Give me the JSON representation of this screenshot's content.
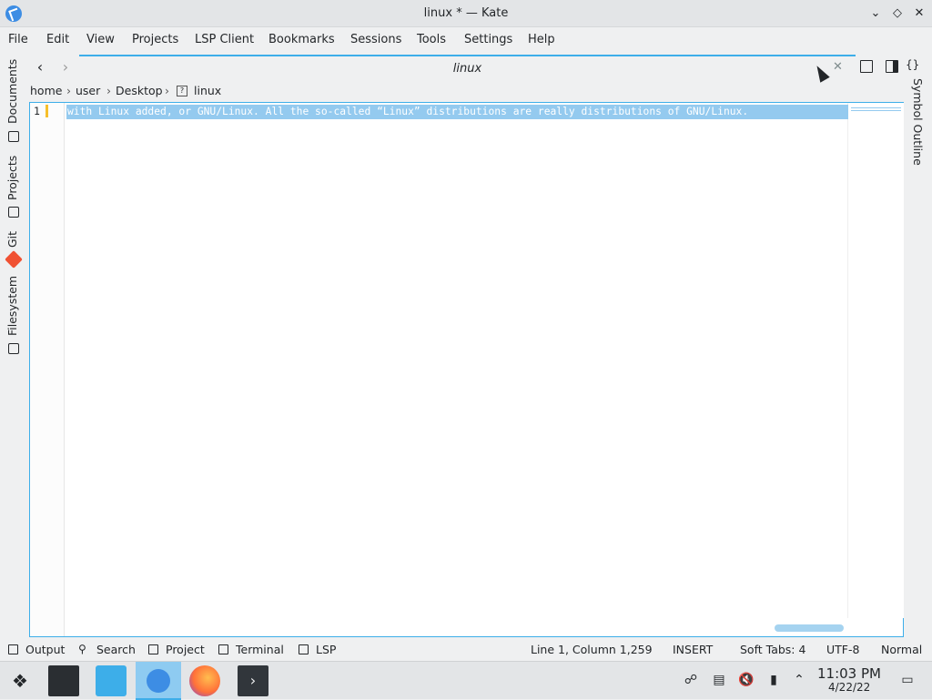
{
  "window": {
    "title": "linux * — Kate",
    "controls": [
      "minimize",
      "maximize",
      "close"
    ]
  },
  "menubar": {
    "items": [
      "File",
      "Edit",
      "View",
      "Projects",
      "LSP Client",
      "Bookmarks",
      "Sessions",
      "Tools",
      "Settings",
      "Help"
    ]
  },
  "left_sidebar": {
    "tabs": [
      "Documents",
      "Projects",
      "Git",
      "Filesystem"
    ]
  },
  "right_sidebar": {
    "tabs": [
      "Symbol Outline"
    ]
  },
  "tabs": {
    "active": "linux"
  },
  "breadcrumb": {
    "items": [
      "home",
      "user",
      "Desktop",
      "linux"
    ]
  },
  "editor": {
    "line_number": "1",
    "line_text": "with Linux added, or GNU/Linux. All the so-called “Linux” distributions are really distributions of GNU/Linux.",
    "selection_color": "#94caef"
  },
  "statusbar": {
    "left": [
      "Output",
      "Search",
      "Project",
      "Terminal",
      "LSP"
    ],
    "position": "Line 1, Column 1,259",
    "mode": "INSERT",
    "indent": "Soft Tabs: 4",
    "encoding": "UTF-8",
    "input_mode": "Normal"
  },
  "taskbar": {
    "apps": [
      "application-launcher",
      "system-settings",
      "discover",
      "kate",
      "firefox",
      "terminal"
    ],
    "active_app": "kate",
    "time": "11:03 PM",
    "date": "4/22/22"
  },
  "colors": {
    "accent": "#3daee9",
    "background": "#eff0f1"
  }
}
